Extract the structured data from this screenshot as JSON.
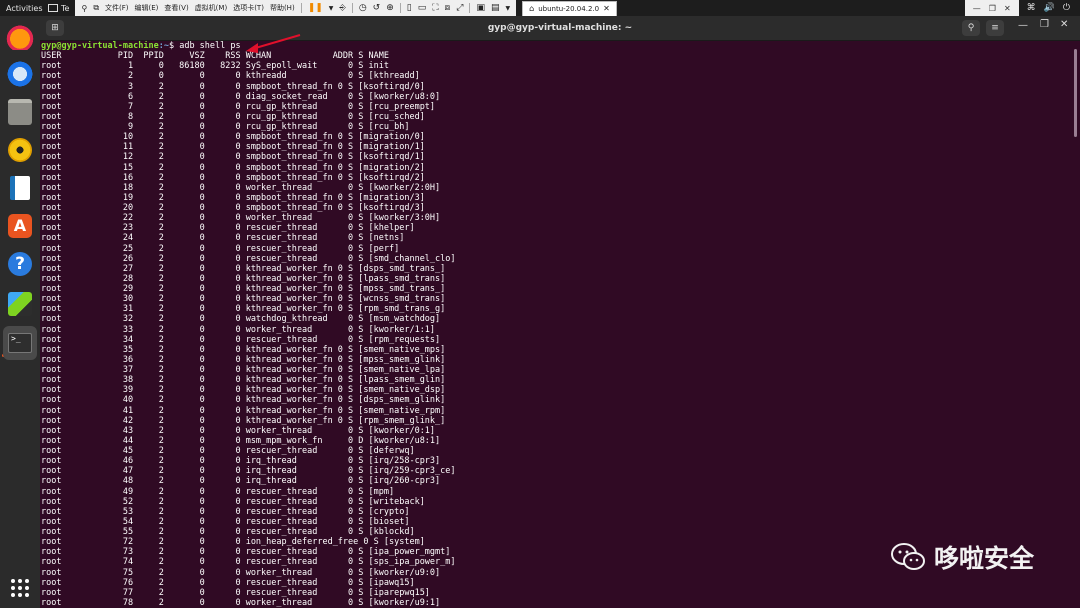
{
  "system_bar": {
    "activities": "Activities",
    "te": "Te",
    "vm_menus": [
      "文件(F)",
      "编辑(E)",
      "查看(V)",
      "虚拟机(M)",
      "选项卡(T)",
      "帮助(H)"
    ],
    "vm_tab_label": "ubuntu-20.04.2.0"
  },
  "window": {
    "title": "gyp@gyp-virtual-machine: ~"
  },
  "terminal": {
    "prompt_user": "gyp@gyp-virtual-machine",
    "prompt_path": ":~",
    "prompt_symbol": "$ ",
    "command": "adb shell ps",
    "header": "USER           PID  PPID     VSZ    RSS WCHAN            ADDR S NAME",
    "rows": [
      [
        "root",
        "1",
        "0",
        "86180",
        "8232",
        "SyS_epoll_wait",
        "0",
        "S",
        "init"
      ],
      [
        "root",
        "2",
        "0",
        "0",
        "0",
        "kthreadd",
        "0",
        "S",
        "[kthreadd]"
      ],
      [
        "root",
        "3",
        "2",
        "0",
        "0",
        "smpboot_thread_fn",
        "0",
        "S",
        "[ksoftirqd/0]"
      ],
      [
        "root",
        "6",
        "2",
        "0",
        "0",
        "diag_socket_read",
        "0",
        "S",
        "[kworker/u8:0]"
      ],
      [
        "root",
        "7",
        "2",
        "0",
        "0",
        "rcu_gp_kthread",
        "0",
        "S",
        "[rcu_preempt]"
      ],
      [
        "root",
        "8",
        "2",
        "0",
        "0",
        "rcu_gp_kthread",
        "0",
        "S",
        "[rcu_sched]"
      ],
      [
        "root",
        "9",
        "2",
        "0",
        "0",
        "rcu_gp_kthread",
        "0",
        "S",
        "[rcu_bh]"
      ],
      [
        "root",
        "10",
        "2",
        "0",
        "0",
        "smpboot_thread_fn",
        "0",
        "S",
        "[migration/0]"
      ],
      [
        "root",
        "11",
        "2",
        "0",
        "0",
        "smpboot_thread_fn",
        "0",
        "S",
        "[migration/1]"
      ],
      [
        "root",
        "12",
        "2",
        "0",
        "0",
        "smpboot_thread_fn",
        "0",
        "S",
        "[ksoftirqd/1]"
      ],
      [
        "root",
        "15",
        "2",
        "0",
        "0",
        "smpboot_thread_fn",
        "0",
        "S",
        "[migration/2]"
      ],
      [
        "root",
        "16",
        "2",
        "0",
        "0",
        "smpboot_thread_fn",
        "0",
        "S",
        "[ksoftirqd/2]"
      ],
      [
        "root",
        "18",
        "2",
        "0",
        "0",
        "worker_thread",
        "0",
        "S",
        "[kworker/2:0H]"
      ],
      [
        "root",
        "19",
        "2",
        "0",
        "0",
        "smpboot_thread_fn",
        "0",
        "S",
        "[migration/3]"
      ],
      [
        "root",
        "20",
        "2",
        "0",
        "0",
        "smpboot_thread_fn",
        "0",
        "S",
        "[ksoftirqd/3]"
      ],
      [
        "root",
        "22",
        "2",
        "0",
        "0",
        "worker_thread",
        "0",
        "S",
        "[kworker/3:0H]"
      ],
      [
        "root",
        "23",
        "2",
        "0",
        "0",
        "rescuer_thread",
        "0",
        "S",
        "[khelper]"
      ],
      [
        "root",
        "24",
        "2",
        "0",
        "0",
        "rescuer_thread",
        "0",
        "S",
        "[netns]"
      ],
      [
        "root",
        "25",
        "2",
        "0",
        "0",
        "rescuer_thread",
        "0",
        "S",
        "[perf]"
      ],
      [
        "root",
        "26",
        "2",
        "0",
        "0",
        "rescuer_thread",
        "0",
        "S",
        "[smd_channel_clo]"
      ],
      [
        "root",
        "27",
        "2",
        "0",
        "0",
        "kthread_worker_fn",
        "0",
        "S",
        "[dsps_smd_trans_]"
      ],
      [
        "root",
        "28",
        "2",
        "0",
        "0",
        "kthread_worker_fn",
        "0",
        "S",
        "[lpass_smd_trans]"
      ],
      [
        "root",
        "29",
        "2",
        "0",
        "0",
        "kthread_worker_fn",
        "0",
        "S",
        "[mpss_smd_trans_]"
      ],
      [
        "root",
        "30",
        "2",
        "0",
        "0",
        "kthread_worker_fn",
        "0",
        "S",
        "[wcnss_smd_trans]"
      ],
      [
        "root",
        "31",
        "2",
        "0",
        "0",
        "kthread_worker_fn",
        "0",
        "S",
        "[rpm_smd_trans_g]"
      ],
      [
        "root",
        "32",
        "2",
        "0",
        "0",
        "watchdog_kthread",
        "0",
        "S",
        "[msm_watchdog]"
      ],
      [
        "root",
        "33",
        "2",
        "0",
        "0",
        "worker_thread",
        "0",
        "S",
        "[kworker/1:1]"
      ],
      [
        "root",
        "34",
        "2",
        "0",
        "0",
        "rescuer_thread",
        "0",
        "S",
        "[rpm_requests]"
      ],
      [
        "root",
        "35",
        "2",
        "0",
        "0",
        "kthread_worker_fn",
        "0",
        "S",
        "[smem_native_mps]"
      ],
      [
        "root",
        "36",
        "2",
        "0",
        "0",
        "kthread_worker_fn",
        "0",
        "S",
        "[mpss_smem_glink]"
      ],
      [
        "root",
        "37",
        "2",
        "0",
        "0",
        "kthread_worker_fn",
        "0",
        "S",
        "[smem_native_lpa]"
      ],
      [
        "root",
        "38",
        "2",
        "0",
        "0",
        "kthread_worker_fn",
        "0",
        "S",
        "[lpass_smem_glin]"
      ],
      [
        "root",
        "39",
        "2",
        "0",
        "0",
        "kthread_worker_fn",
        "0",
        "S",
        "[smem_native_dsp]"
      ],
      [
        "root",
        "40",
        "2",
        "0",
        "0",
        "kthread_worker_fn",
        "0",
        "S",
        "[dsps_smem_glink]"
      ],
      [
        "root",
        "41",
        "2",
        "0",
        "0",
        "kthread_worker_fn",
        "0",
        "S",
        "[smem_native_rpm]"
      ],
      [
        "root",
        "42",
        "2",
        "0",
        "0",
        "kthread_worker_fn",
        "0",
        "S",
        "[rpm_smem_glink_]"
      ],
      [
        "root",
        "43",
        "2",
        "0",
        "0",
        "worker_thread",
        "0",
        "S",
        "[kworker/0:1]"
      ],
      [
        "root",
        "44",
        "2",
        "0",
        "0",
        "msm_mpm_work_fn",
        "0",
        "D",
        "[kworker/u8:1]"
      ],
      [
        "root",
        "45",
        "2",
        "0",
        "0",
        "rescuer_thread",
        "0",
        "S",
        "[deferwq]"
      ],
      [
        "root",
        "46",
        "2",
        "0",
        "0",
        "irq_thread",
        "0",
        "S",
        "[irq/258-cpr3]"
      ],
      [
        "root",
        "47",
        "2",
        "0",
        "0",
        "irq_thread",
        "0",
        "S",
        "[irq/259-cpr3_ce]"
      ],
      [
        "root",
        "48",
        "2",
        "0",
        "0",
        "irq_thread",
        "0",
        "S",
        "[irq/260-cpr3]"
      ],
      [
        "root",
        "49",
        "2",
        "0",
        "0",
        "rescuer_thread",
        "0",
        "S",
        "[mpm]"
      ],
      [
        "root",
        "52",
        "2",
        "0",
        "0",
        "rescuer_thread",
        "0",
        "S",
        "[writeback]"
      ],
      [
        "root",
        "53",
        "2",
        "0",
        "0",
        "rescuer_thread",
        "0",
        "S",
        "[crypto]"
      ],
      [
        "root",
        "54",
        "2",
        "0",
        "0",
        "rescuer_thread",
        "0",
        "S",
        "[bioset]"
      ],
      [
        "root",
        "55",
        "2",
        "0",
        "0",
        "rescuer_thread",
        "0",
        "S",
        "[kblockd]"
      ],
      [
        "root",
        "72",
        "2",
        "0",
        "0",
        "ion_heap_deferred_free",
        "0",
        "S",
        "[system]"
      ],
      [
        "root",
        "73",
        "2",
        "0",
        "0",
        "rescuer_thread",
        "0",
        "S",
        "[ipa_power_mgmt]"
      ],
      [
        "root",
        "74",
        "2",
        "0",
        "0",
        "rescuer_thread",
        "0",
        "S",
        "[sps_ipa_power_m]"
      ],
      [
        "root",
        "75",
        "2",
        "0",
        "0",
        "worker_thread",
        "0",
        "S",
        "[kworker/u9:0]"
      ],
      [
        "root",
        "76",
        "2",
        "0",
        "0",
        "rescuer_thread",
        "0",
        "S",
        "[ipawq15]"
      ],
      [
        "root",
        "77",
        "2",
        "0",
        "0",
        "rescuer_thread",
        "0",
        "S",
        "[iparepwq15]"
      ],
      [
        "root",
        "78",
        "2",
        "0",
        "0",
        "worker_thread",
        "0",
        "S",
        "[kworker/u9:1]"
      ]
    ]
  },
  "watermark": {
    "text": "哆啦安全"
  },
  "colors": {
    "terminal_bg": "#300a24",
    "prompt_user": "#8ae234",
    "prompt_path": "#729fcf",
    "arrow": "#e0102b"
  }
}
